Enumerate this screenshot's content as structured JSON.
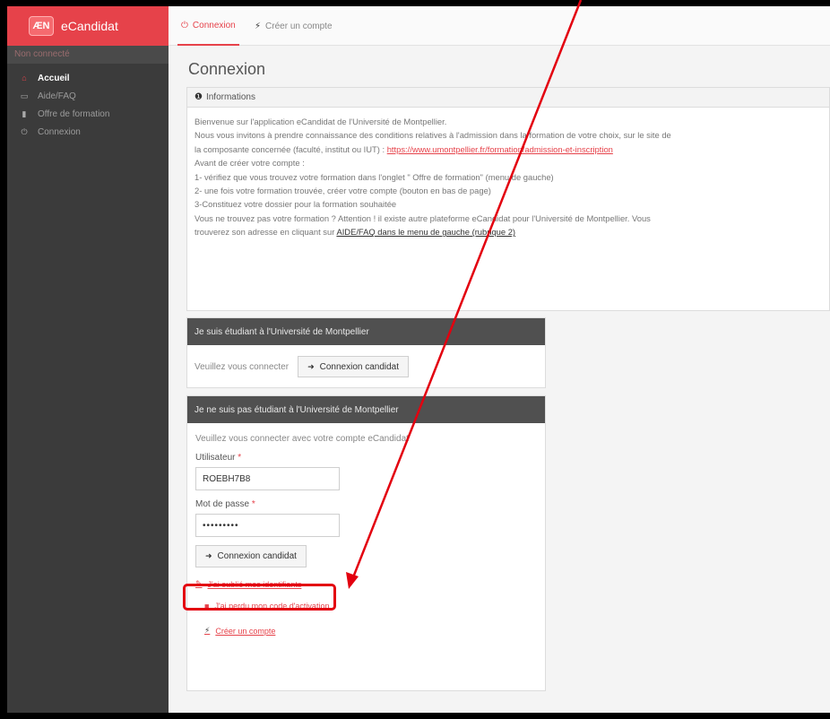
{
  "brand": {
    "logo_text": "ÆN",
    "name": "eCandidat"
  },
  "sidebar": {
    "status": "Non connecté",
    "items": [
      {
        "label": "Accueil",
        "icon": "home-icon",
        "glyph": "⌂"
      },
      {
        "label": "Aide/FAQ",
        "icon": "book-icon",
        "glyph": "▭"
      },
      {
        "label": "Offre de formation",
        "icon": "bookmark-icon",
        "glyph": "▮"
      },
      {
        "label": "Connexion",
        "icon": "power-icon",
        "glyph": "⏻"
      }
    ]
  },
  "tabs": [
    {
      "label": "Connexion",
      "icon": "power-icon"
    },
    {
      "label": "Créer un compte",
      "icon": "magic-wand-icon"
    }
  ],
  "page_title": "Connexion",
  "info": {
    "header": "Informations",
    "line1": "Bienvenue sur l'application eCandidat de l'Université de Montpellier.",
    "line2": "Nous vous invitons à prendre connaissance des conditions relatives à l'admission dans la formation de votre choix, sur le site de",
    "line3_pre": "la composante concernée (faculté, institut ou IUT) : ",
    "line3_link": "https://www.umontpellier.fr/formation/admission-et-inscription",
    "line4": "Avant de créer votre compte :",
    "line5": "1- vérifiez que vous trouvez votre formation dans l'onglet \" Offre de formation\" (menu de gauche)",
    "line6": "2- une fois votre formation trouvée, créer votre compte (bouton en bas de page)",
    "line7": "3-Constituez votre dossier pour la formation souhaitée",
    "line8": "Vous ne trouvez pas votre formation ? Attention ! il existe autre plateforme eCandidat pour l'Université de Montpellier. Vous",
    "line9_pre": "trouverez son adresse en cliquant sur ",
    "line9_link": "AIDE/FAQ dans le menu de gauche (rubrique 2)"
  },
  "um_panel": {
    "header": "Je suis étudiant à l'Université de Montpellier",
    "prompt": "Veuillez vous connecter",
    "button": "Connexion candidat"
  },
  "ext_panel": {
    "header": "Je ne suis pas étudiant à l'Université de Montpellier",
    "prompt": "Veuillez vous connecter avec votre compte eCandidat",
    "user_label": "Utilisateur",
    "user_value": "ROEBH7B8",
    "pass_label": "Mot de passe",
    "pass_value": "•••••••••",
    "button": "Connexion candidat",
    "link_forgot_ids": "J'ai oublié mes identifiants",
    "link_lost_code": "J'ai perdu mon code d'activation",
    "link_create": "Créer un compte"
  },
  "colors": {
    "accent": "#e6424a",
    "sidebar": "#3b3b3b",
    "annotation": "#e3000f"
  }
}
